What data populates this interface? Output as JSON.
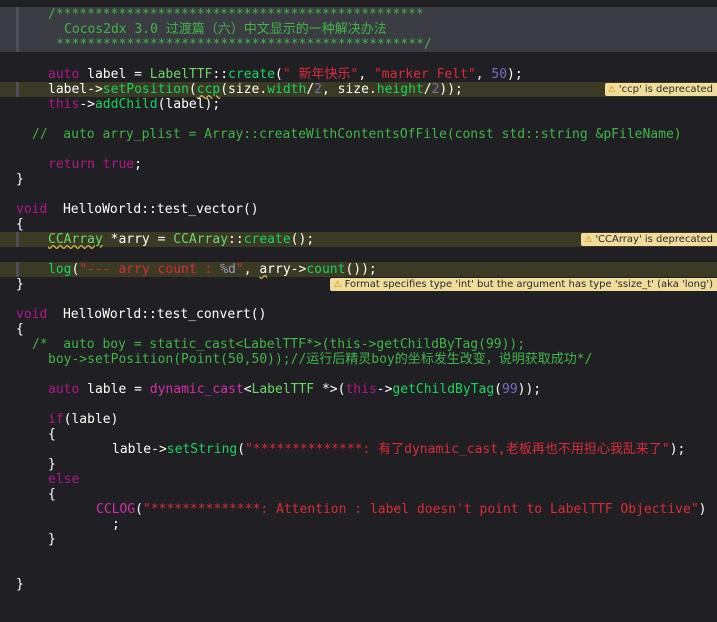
{
  "colors": {
    "background": "#1f1f24",
    "comment": "#41b645",
    "keyword": "#b21889",
    "string": "#db2c38",
    "function": "#19d55c",
    "number": "#786dc4",
    "warning_badge": "#f0dc9b"
  },
  "code": {
    "l1": "/***********************************************",
    "l2": "Cocos2dx 3.0 过渡篇（六）中文显示的一种解决办法",
    "l3": "***********************************************/",
    "l4": {
      "a": "auto",
      "b": " label = ",
      "c": "LabelTTF",
      "d": "::",
      "e": "create",
      "f": "(",
      "g": "\" 新年快乐\"",
      "h": ", ",
      "i": "\"marker Felt\"",
      "j": ", ",
      "k": "50",
      "l": ");"
    },
    "l5": {
      "a": "label->",
      "b": "setPosition",
      "c": "(",
      "d": "ccp",
      "e": "(size.",
      "f": "width",
      "g": "/",
      "h": "2",
      "i": ", size.",
      "j": "height",
      "k": "/",
      "l": "2",
      "m": "));"
    },
    "l6": {
      "a": "this",
      "b": "->",
      "c": "addChild",
      "d": "(label);"
    },
    "l7": "//  auto arry_plist = Array::createWithContentsOfFile(const std::string &pFileName)",
    "l8": {
      "a": "return",
      "b": " ",
      "c": "true",
      "d": ";"
    },
    "l9": "}",
    "l10": {
      "a": "void",
      "b": "  HelloWorld::test_vector()"
    },
    "l11": "{",
    "l12": {
      "a": "CCArray",
      "b": " *arry = ",
      "c": "CCArray",
      "d": "::",
      "e": "create",
      "f": "();"
    },
    "l13": {
      "a": "log",
      "b": "(",
      "c": "\"--- arry count : ",
      "d": "%d",
      "e": "\"",
      "f": ", ",
      "g": "a",
      "h": "rry->",
      "i": "count",
      "j": "());"
    },
    "l14": "}",
    "l15": {
      "a": "void",
      "b": "  HelloWorld::test_convert()"
    },
    "l16": "{",
    "l17": "/*  auto boy = static_cast<LabelTTF*>(this->getChildByTag(99));",
    "l18": "boy->setPosition(Point(50,50));//运行后精灵boy的坐标发生改变，说明获取成功*/",
    "l19": {
      "a": "auto",
      "b": " lable = ",
      "c": "dynamic_cast",
      "d": "<",
      "e": "LabelTTF",
      "f": " *>(",
      "g": "this",
      "h": "->",
      "i": "getChildByTag",
      "j": "(",
      "k": "99",
      "l": "));"
    },
    "l20": {
      "a": "if",
      "b": "(lable)"
    },
    "l21": "{",
    "l22": {
      "a": "lable->",
      "b": "setString",
      "c": "(",
      "d": "\"**************: 有了dynamic_cast,老板再也不用担心我乱来了\"",
      "e": ");"
    },
    "l23": "}",
    "l24": "else",
    "l25": "{",
    "l26": {
      "a": "CCLOG",
      "b": "(",
      "c": "\"**************: Attention : label doesn't point to LabelTTF Objective\"",
      "d": ")"
    },
    "l27": ";",
    "l28": "}",
    "l29": "}"
  },
  "warnings": {
    "w1": "'ccp' is deprecated",
    "w2": "'CCArray' is deprecated",
    "w3": "Format specifies type 'int' but the argument has type 'ssize_t' (aka 'long')"
  },
  "icons": {
    "warning": "warning-triangle-icon"
  }
}
